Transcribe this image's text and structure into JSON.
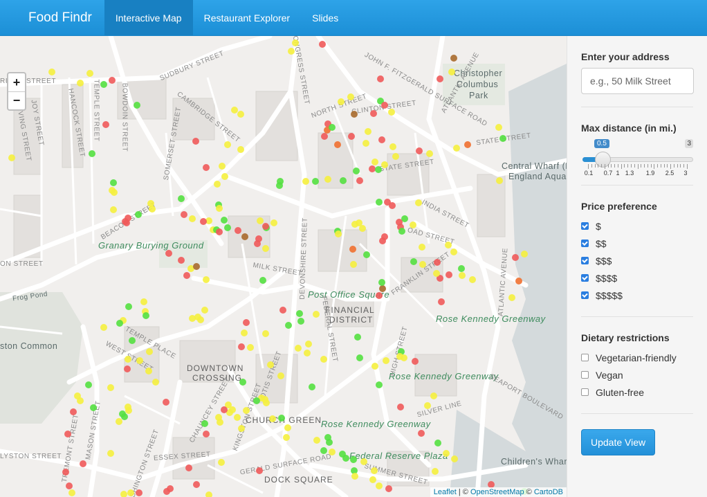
{
  "navbar": {
    "brand": "Food Findr",
    "tabs": [
      {
        "label": "Interactive Map",
        "active": true
      },
      {
        "label": "Restaurant Explorer",
        "active": false
      },
      {
        "label": "Slides",
        "active": false
      }
    ]
  },
  "map": {
    "zoom_in": "+",
    "zoom_out": "−",
    "attribution": {
      "leaflet": "Leaflet",
      "sep1": " | © ",
      "osm": "OpenStreetMap",
      "sep2": " © ",
      "carto": "CartoDB"
    },
    "labels": {
      "christopher": "Christopher",
      "columbus": "Columbus",
      "park": "Park",
      "central_wharf": "Central Wharf (N",
      "england_aqua": "England Aquar",
      "granary": "Granary Burying Ground",
      "post_office": "Post Office Square",
      "financial": "FINANCIAL",
      "district": "DISTRICT",
      "rkg1": "Rose Kennedy Greenway",
      "rkg2": "Rose Kennedy Greenway",
      "rkg3": "Rose Kennedy Greenway",
      "downtown": "DOWNTOWN",
      "crossing": "CROSSING",
      "church_green": "CHURCH GREEN",
      "federal_reserve": "Federal Reserve Plaza",
      "dock_square": "DOCK SQUARE",
      "frog_pond": "Frog Pond",
      "common": "ston Common",
      "childrens": "Children's Whar",
      "s_bridge": "RIDGE STREET",
      "s_sudbury": "SUDBURY STREET",
      "s_cambridge": "CAMBRIDGE STREET",
      "s_beacon": "BEACON STREET",
      "s_milk": "MILK STREET",
      "s_state": "STATE STREET",
      "s_india": "INDIA STREET",
      "s_franklin": "FRANKLIN STREET",
      "s_high": "HIGH STREET",
      "s_essex": "ESSEX STREET",
      "s_congress": "CONGRESS STREET",
      "s_devonshire": "DEVONSHIRE STREET",
      "s_federal": "FEDERAL STREET",
      "s_washington": "WASHINGTON STREET",
      "s_atlantic": "ATLANTIC AVENUE",
      "s_north": "NORTH STREET",
      "s_clinton": "CLINTON STREET",
      "s_fitzgerald": "JOHN F. FITZGERALD SURFACE ROAD",
      "s_silver": "SILVER LINE",
      "s_seaport": "SEAPORT BOULEVARD",
      "s_summer": "SUMMER STREET",
      "s_boylston": "LYSTON STREET",
      "s_tremont": "TREMONT STREET",
      "s_mason": "MASON STREET",
      "s_temple": "TEMPLE PLACE",
      "s_west": "WEST STREET",
      "s_kingston": "KINGSTON STREET",
      "s_otis": "OTIS STREET",
      "s_chauncey": "CHAUNCEY STREET",
      "s_hancock": "HANCOCK STREET",
      "s_joy": "JOY STREET",
      "s_bowdoin": "BOWDOIN STREET",
      "s_irving": "IRVING STREET",
      "s_somerset": "SOMERSET STREET",
      "s_templestreet": "TEMPLE STREET",
      "s_street": "STREET",
      "s_on_street": "ON STREET",
      "s_broad": "OAD STREET",
      "s_gerald": "GERALD SURFACE ROAD"
    },
    "marker_colors": {
      "red": "#ef5a5a",
      "yellow": "#f5f03e",
      "green": "#54e040",
      "orange": "#f07030",
      "brown": "#a86a2c",
      "lime": "#b8ec3c"
    }
  },
  "sidebar": {
    "address": {
      "label": "Enter your address",
      "placeholder": "e.g., 50 Milk Street",
      "value": ""
    },
    "distance": {
      "label": "Max distance (in mi.)",
      "value": "0.5",
      "max": "3",
      "tick_labels": [
        "0.1",
        "0.7",
        "1",
        "1.3",
        "1.9",
        "2.5",
        "3"
      ]
    },
    "price": {
      "label": "Price preference",
      "options": [
        {
          "label": "$",
          "checked": true
        },
        {
          "label": "$$",
          "checked": true
        },
        {
          "label": "$$$",
          "checked": true
        },
        {
          "label": "$$$$",
          "checked": true
        },
        {
          "label": "$$$$$",
          "checked": true
        }
      ]
    },
    "dietary": {
      "label": "Dietary restrictions",
      "options": [
        {
          "label": "Vegetarian-friendly",
          "checked": false
        },
        {
          "label": "Vegan",
          "checked": false
        },
        {
          "label": "Gluten-free",
          "checked": false
        }
      ]
    },
    "update_button": "Update View"
  }
}
